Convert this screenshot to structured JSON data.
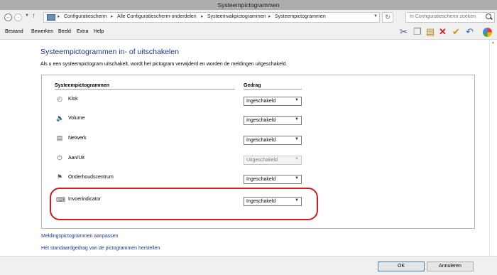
{
  "window": {
    "title": "Systeempictogrammen"
  },
  "address": {
    "breadcrumbs": [
      "Configuratiescherm",
      "Alle Configuratiescherm-onderdelen",
      "Systeemvakpictogrammen",
      "Systeempictogrammen"
    ],
    "search_placeholder": "In Configuratiescherm zoeken"
  },
  "menu": [
    "Bestand",
    "Bewerken",
    "Beeld",
    "Extra",
    "Help"
  ],
  "toolbar_icons": [
    "cut-icon",
    "copy-icon",
    "paste-icon",
    "delete-icon",
    "check-icon",
    "undo-icon",
    "help-icon"
  ],
  "main": {
    "heading": "Systeempictogrammen in- of uitschakelen",
    "description": "Als u een systeempictogram uitschakelt, wordt het pictogram verwijderd en worden de meldingen uitgeschakeld.",
    "col_icons": "Systeempictogrammen",
    "col_behavior": "Gedrag",
    "rows": [
      {
        "label": "Klok",
        "icon": "clock-icon",
        "value": "Ingeschakeld",
        "enabled": true
      },
      {
        "label": "Volume",
        "icon": "speaker-icon",
        "value": "Ingeschakeld",
        "enabled": true
      },
      {
        "label": "Netwerk",
        "icon": "network-icon",
        "value": "Ingeschakeld",
        "enabled": true
      },
      {
        "label": "Aan/Uit",
        "icon": "power-icon",
        "value": "Uitgeschakeld",
        "enabled": false
      },
      {
        "label": "Onderhoudscentrum",
        "icon": "flag-icon",
        "value": "Ingeschakeld",
        "enabled": true
      },
      {
        "label": "Invoerindicator",
        "icon": "keyboard-icon",
        "value": "Ingeschakeld",
        "enabled": true
      }
    ],
    "links": [
      "Meldingspictogrammen aanpassen",
      "Het standaardgedrag van de pictogrammen herstellen"
    ]
  },
  "footer": {
    "ok": "OK",
    "cancel": "Annuleren"
  },
  "colors": {
    "accent": "#1e3287",
    "highlight": "#d21c1c"
  }
}
